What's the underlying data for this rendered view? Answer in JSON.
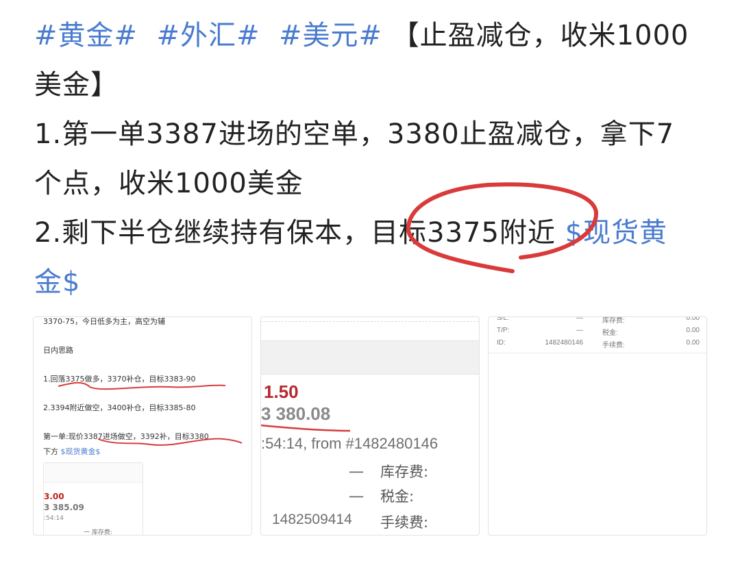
{
  "post": {
    "tags": [
      "#黄金#",
      "#外汇#",
      "#美元#"
    ],
    "title_part1": "【止盈减仓，收米1000",
    "title_part2": "美金】",
    "item1_line1": "1.第一单3387进场的空单，3380止盈减仓，拿下7",
    "item1_line2": "个点，收米1000美金",
    "item2_line1": "2.剩下半仓继续持有保本，目标3375附近",
    "item2_tag": "$现货黄",
    "item2_tag_end": "金$"
  },
  "thumb1": {
    "line_top": "3370-75，今日低多为主，高空为辅",
    "heading": "日内思路",
    "plan1": "1.回落3375做多，3370补仓，目标3383-90",
    "plan2": "2.3394附近做空，3400补仓，目标3385-80",
    "order": "第一单:现价3387进场做空，3392补，目标3380",
    "order_end": "下方",
    "order_tag": "$现货黄金$",
    "card_red": "3.00",
    "card_price": "3 385.09",
    "card_time": ":54:14",
    "card_fee": "一    库存费:"
  },
  "thumb2": {
    "red_value": "1.50",
    "price": "3 380.08",
    "from_line": ":54:14, from #1482480146",
    "dash": "一",
    "label_storage": "库存费:",
    "label_tax": "税金:",
    "account": "1482509414",
    "label_fee": "手续费:"
  },
  "thumb3": {
    "rows": [
      {
        "k": "S/L:",
        "v": "—",
        "k2": "库存费:",
        "v2": "0.00"
      },
      {
        "k": "T/P:",
        "v": "—",
        "k2": "税金:",
        "v2": "0.00"
      },
      {
        "k": "ID:",
        "v": "1482480146",
        "k2": "手续费:",
        "v2": "0.00"
      }
    ]
  },
  "colors": {
    "tag": "#4a7bd0",
    "annotation": "#d93a3a",
    "price_red": "#b3282d"
  }
}
